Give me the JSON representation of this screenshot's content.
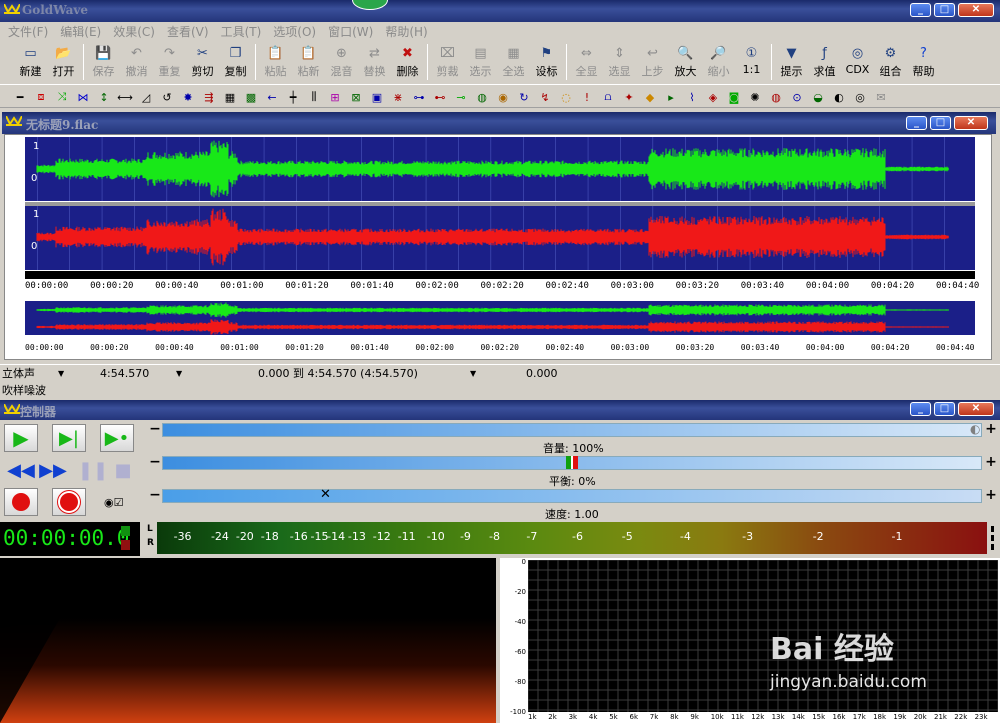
{
  "app": {
    "title": "GoldWave"
  },
  "menu": [
    "文件(F)",
    "编辑(E)",
    "效果(C)",
    "查看(V)",
    "工具(T)",
    "选项(O)",
    "窗口(W)",
    "帮助(H)"
  ],
  "toolbar": [
    {
      "label": "新建",
      "enabled": true,
      "icon": "new-icon"
    },
    {
      "label": "打开",
      "enabled": true,
      "icon": "open-icon"
    },
    {
      "label": "保存",
      "enabled": false,
      "icon": "save-icon"
    },
    {
      "label": "撤消",
      "enabled": false,
      "icon": "undo-icon"
    },
    {
      "label": "重复",
      "enabled": false,
      "icon": "redo-icon"
    },
    {
      "label": "剪切",
      "enabled": true,
      "icon": "cut-icon"
    },
    {
      "label": "复制",
      "enabled": true,
      "icon": "copy-icon"
    },
    {
      "label": "粘贴",
      "enabled": false,
      "icon": "paste-icon"
    },
    {
      "label": "粘新",
      "enabled": false,
      "icon": "paste-new-icon"
    },
    {
      "label": "混音",
      "enabled": false,
      "icon": "mix-icon"
    },
    {
      "label": "替换",
      "enabled": false,
      "icon": "replace-icon"
    },
    {
      "label": "删除",
      "enabled": true,
      "icon": "delete-icon"
    },
    {
      "label": "剪裁",
      "enabled": false,
      "icon": "trim-icon"
    },
    {
      "label": "选示",
      "enabled": false,
      "icon": "select-view-icon"
    },
    {
      "label": "全选",
      "enabled": false,
      "icon": "select-all-icon"
    },
    {
      "label": "设标",
      "enabled": true,
      "icon": "set-marker-icon"
    },
    {
      "label": "全显",
      "enabled": false,
      "icon": "view-all-icon"
    },
    {
      "label": "选显",
      "enabled": false,
      "icon": "view-selection-icon"
    },
    {
      "label": "上步",
      "enabled": false,
      "icon": "previous-icon"
    },
    {
      "label": "放大",
      "enabled": true,
      "icon": "zoom-in-icon"
    },
    {
      "label": "缩小",
      "enabled": false,
      "icon": "zoom-out-icon"
    },
    {
      "label": "1:1",
      "enabled": true,
      "icon": "zoom-1to1-icon"
    },
    {
      "label": "提示",
      "enabled": true,
      "icon": "cue-icon"
    },
    {
      "label": "求值",
      "enabled": true,
      "icon": "evaluate-icon"
    },
    {
      "label": "CDX",
      "enabled": true,
      "icon": "cd-extract-icon"
    },
    {
      "label": "组合",
      "enabled": true,
      "icon": "batch-icon"
    },
    {
      "label": "帮助",
      "enabled": true,
      "icon": "help-icon"
    }
  ],
  "effects_toolbar": [
    "effect-1-icon",
    "effect-2-icon",
    "effect-3-icon",
    "effect-4-icon",
    "effect-5-icon",
    "effect-6-icon",
    "effect-7-icon",
    "effect-8-icon",
    "effect-9-icon",
    "effect-10-icon",
    "effect-11-icon",
    "effect-12-icon",
    "effect-13-icon",
    "effect-14-icon",
    "effect-15-icon",
    "effect-16-icon",
    "effect-17-icon",
    "effect-18-icon",
    "effect-19-icon",
    "effect-20-icon",
    "effect-21-icon",
    "effect-22-icon",
    "effect-23-icon",
    "effect-24-icon",
    "effect-25-icon",
    "effect-26-icon",
    "effect-27-icon",
    "effect-28-icon",
    "effect-29-icon",
    "effect-30-icon",
    "effect-31-icon",
    "effect-32-icon",
    "effect-33-icon",
    "effect-34-icon",
    "effect-35-icon",
    "effect-36-icon",
    "effect-37-icon",
    "effect-38-icon",
    "effect-39-icon",
    "effect-40-icon",
    "effect-41-icon",
    "effect-42-icon"
  ],
  "document": {
    "title": "无标题9.flac",
    "channel_labels": {
      "top": "1",
      "zero": "0"
    },
    "time_ticks": [
      "00:00:00",
      "00:00:20",
      "00:00:40",
      "00:01:00",
      "00:01:20",
      "00:01:40",
      "00:02:00",
      "00:02:20",
      "00:02:40",
      "00:03:00",
      "00:03:20",
      "00:03:40",
      "00:04:00",
      "00:04:20",
      "00:04:40"
    ],
    "overview_ticks": [
      "00:00:00",
      "00:00:20",
      "00:00:40",
      "00:01:00",
      "00:01:20",
      "00:01:40",
      "00:02:00",
      "00:02:20",
      "00:02:40",
      "00:03:00",
      "00:03:20",
      "00:03:40",
      "00:04:00",
      "00:04:20",
      "00:04:40"
    ],
    "colors": {
      "left": "#18e818",
      "right": "#f01818",
      "background": "#1b1f88"
    }
  },
  "status": {
    "channels": "立体声",
    "length": "4:54.570",
    "selection": "0.000 到 4:54.570 (4:54.570)",
    "position": "0.000",
    "message": "吹样噪波"
  },
  "controller": {
    "title": "控制器",
    "volume": "音量: 100%",
    "volume_fraction": 1.0,
    "balance": "平衡: 0%",
    "balance_fraction": 0.5,
    "speed": "速度: 1.00",
    "speed_fraction": 0.2,
    "time": "00:00:00.0",
    "vu_scale": [
      "-36",
      "-24",
      "-20",
      "-18",
      "-16",
      "-15",
      "-14",
      "-13",
      "-12",
      "-11",
      "-10",
      "-9",
      "-8",
      "-7",
      "-6",
      "-5",
      "-4",
      "-3",
      "-2",
      "-1"
    ],
    "vu_channels": [
      "L",
      "R"
    ]
  },
  "spectrum": {
    "y_ticks": [
      "0",
      "-20",
      "-40",
      "-60",
      "-80",
      "-100"
    ],
    "x_ticks": [
      "1k",
      "2k",
      "3k",
      "4k",
      "5k",
      "6k",
      "7k",
      "8k",
      "9k",
      "10k",
      "11k",
      "12k",
      "13k",
      "14k",
      "15k",
      "16k",
      "17k",
      "18k",
      "19k",
      "20k",
      "21k",
      "22k",
      "23k"
    ]
  },
  "watermark": {
    "text": "Bai 经验",
    "url": "jingyan.baidu.com"
  }
}
